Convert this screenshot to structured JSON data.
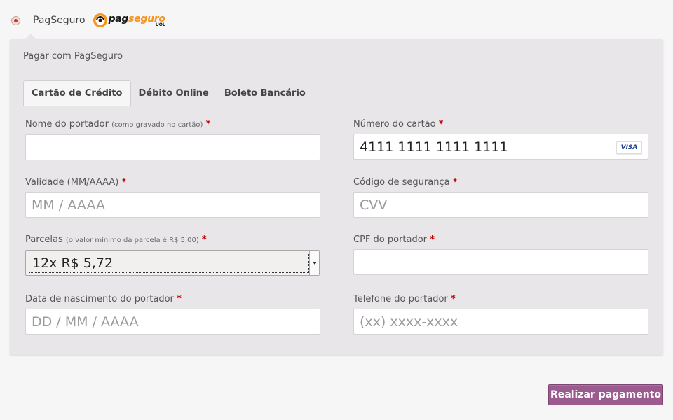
{
  "payment_method": {
    "label": "PagSeguro",
    "selected": true,
    "logo": {
      "name_part1": "pag",
      "name_part2": "seguro",
      "sub": "UOL"
    }
  },
  "panel": {
    "title": "Pagar com PagSeguro",
    "tabs": [
      {
        "label": "Cartão de Crédito",
        "active": true
      },
      {
        "label": "Débito Online",
        "active": false
      },
      {
        "label": "Boleto Bancário",
        "active": false
      }
    ]
  },
  "form": {
    "required_mark": "*",
    "holder_name": {
      "label": "Nome do portador",
      "hint": "(como gravado no cartão)",
      "value": ""
    },
    "card_number": {
      "label": "Número do cartão",
      "value": "4111 1111 1111 1111",
      "brand": "VISA"
    },
    "expiry": {
      "label": "Validade (MM/AAAA)",
      "placeholder": "MM / AAAA"
    },
    "cvv": {
      "label": "Código de segurança",
      "placeholder": "CVV"
    },
    "installments": {
      "label": "Parcelas",
      "hint": "(o valor mínimo da parcela é R$ 5,00)",
      "selected": "12x R$ 5,72"
    },
    "cpf": {
      "label": "CPF do portador",
      "value": ""
    },
    "birth_date": {
      "label": "Data de nascimento do portador",
      "placeholder": "DD / MM / AAAA"
    },
    "phone": {
      "label": "Telefone do portador",
      "placeholder": "(xx) xxxx-xxxx"
    }
  },
  "submit_label": "Realizar pagamento",
  "colors": {
    "accent": "#9b5b8e",
    "required": "#c20000",
    "panel_bg": "#e9e6ea",
    "logo_orange": "#f7931e"
  }
}
